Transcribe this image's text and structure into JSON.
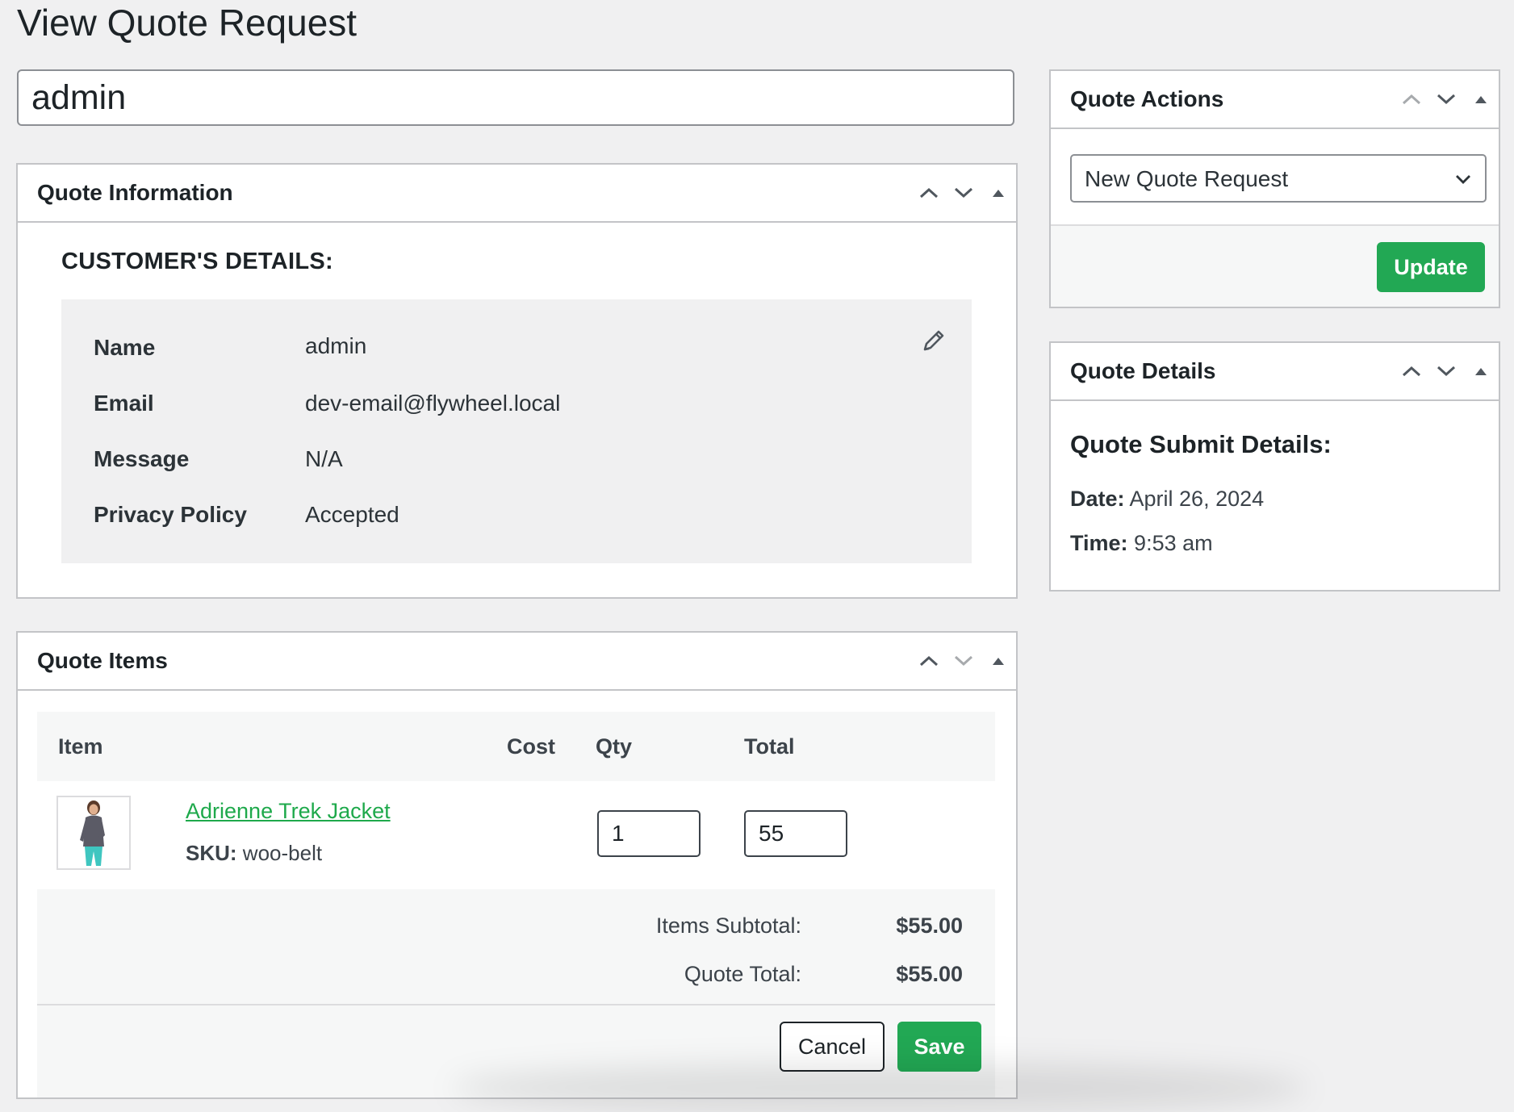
{
  "page": {
    "title": "View Quote Request"
  },
  "title_field": {
    "value": "admin"
  },
  "quote_information": {
    "title": "Quote Information",
    "customer_heading": "CUSTOMER'S DETAILS:",
    "fields": [
      {
        "label": "Name",
        "value": "admin"
      },
      {
        "label": "Email",
        "value": "dev-email@flywheel.local"
      },
      {
        "label": "Message",
        "value": "N/A"
      },
      {
        "label": "Privacy Policy",
        "value": "Accepted"
      }
    ]
  },
  "quote_items": {
    "title": "Quote Items",
    "columns": {
      "item": "Item",
      "cost": "Cost",
      "qty": "Qty",
      "total": "Total"
    },
    "items": [
      {
        "name": "Adrienne Trek Jacket",
        "sku_label": "SKU:",
        "sku": "woo-belt",
        "qty": "1",
        "total": "55"
      }
    ],
    "subtotal_label": "Items Subtotal:",
    "subtotal_value": "$55.00",
    "total_label": "Quote Total:",
    "total_value": "$55.00",
    "cancel_label": "Cancel",
    "save_label": "Save"
  },
  "quote_actions": {
    "title": "Quote Actions",
    "status_selected": "New Quote Request",
    "update_label": "Update"
  },
  "quote_details": {
    "title": "Quote Details",
    "heading": "Quote Submit Details:",
    "date_label": "Date:",
    "date_value": "April 26, 2024",
    "time_label": "Time:",
    "time_value": "9:53 am"
  },
  "colors": {
    "accent_green": "#22a854",
    "link_green": "#1ea94b",
    "background": "#f0f0f1"
  },
  "icons": [
    "chevron-up-icon",
    "chevron-down-icon",
    "collapse-toggle-icon",
    "pencil-icon",
    "select-chevron-icon",
    "product-thumbnail"
  ]
}
